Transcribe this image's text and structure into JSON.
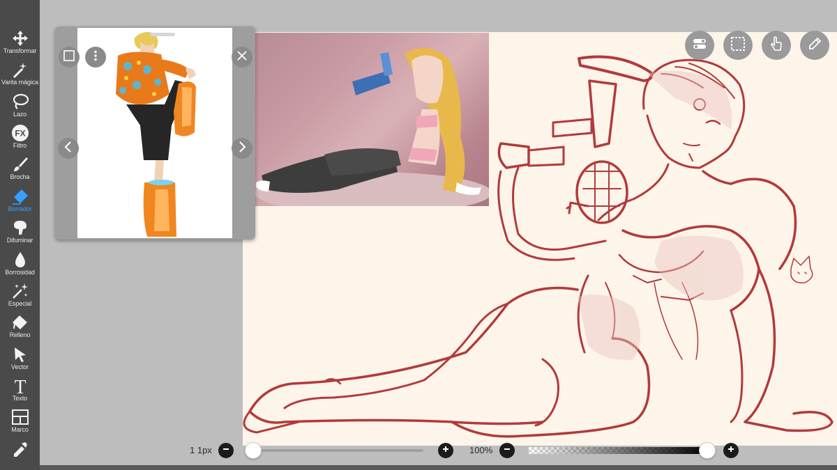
{
  "toolbar": {
    "items": [
      {
        "label": "Transformar",
        "icon": "move-arrows-icon"
      },
      {
        "label": "Varita mágica",
        "icon": "magic-wand-icon"
      },
      {
        "label": "Lazo",
        "icon": "lasso-icon"
      },
      {
        "label": "Filtro",
        "icon": "fx-icon",
        "glyph": "FX"
      },
      {
        "label": "Brocha",
        "icon": "brush-icon"
      },
      {
        "label": "Borrador",
        "icon": "eraser-icon",
        "active": true
      },
      {
        "label": "Difuminar",
        "icon": "smudge-icon"
      },
      {
        "label": "Borrosidad",
        "icon": "blur-drop-icon"
      },
      {
        "label": "Especial",
        "icon": "sparkle-icon"
      },
      {
        "label": "Relleno",
        "icon": "fill-bucket-icon"
      },
      {
        "label": "Vector",
        "icon": "cursor-arrow-icon"
      },
      {
        "label": "Texto",
        "icon": "text-icon",
        "glyph": "T"
      },
      {
        "label": "Marco",
        "icon": "frame-icon"
      },
      {
        "label": "",
        "icon": "eyedropper-icon"
      }
    ],
    "active_color": "#34a0ff"
  },
  "bottom": {
    "brush_size": "1 1px",
    "brush_size_slider_value": 0.0,
    "zoom": "100%",
    "opacity_slider_value": 1.0
  },
  "colors": {
    "toolbar_bg": "#4a4a4a",
    "workspace_bg": "#bdbdbd",
    "canvas_bg": "#fdf4ea",
    "line_art": "#b23a3a"
  }
}
